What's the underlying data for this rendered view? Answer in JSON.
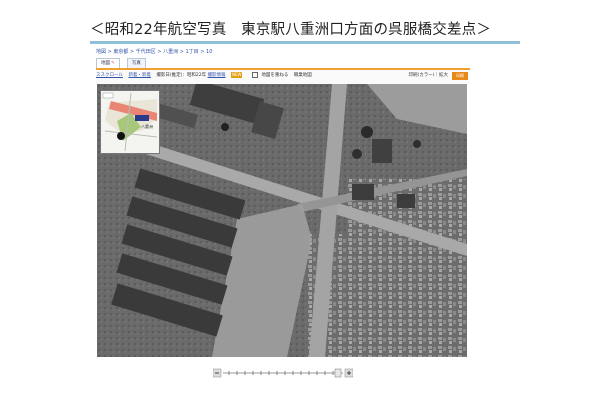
{
  "caption": "＜昭和22年航空写真　東京駅八重洲口方面の呉服橋交差点＞",
  "breadcrumb": "地図 > 東京都 > 千代田区 > 八重洲 > 1丁目 > 10",
  "tabs": [
    {
      "label": "地図"
    },
    {
      "label": "写真"
    }
  ],
  "toolbar": {
    "link1": "ススクロール",
    "link2": "新着・新着",
    "date_text": "撮影日(推定)：昭和22年",
    "link3": "撮影情報",
    "badge": "NEW",
    "checkbox_label": "地図を重ねる",
    "extra_label": "職業地図",
    "right_text": "印刷(カラー)｜拡大",
    "print_label": "印刷"
  },
  "minimap": {
    "label": "八重洲"
  }
}
